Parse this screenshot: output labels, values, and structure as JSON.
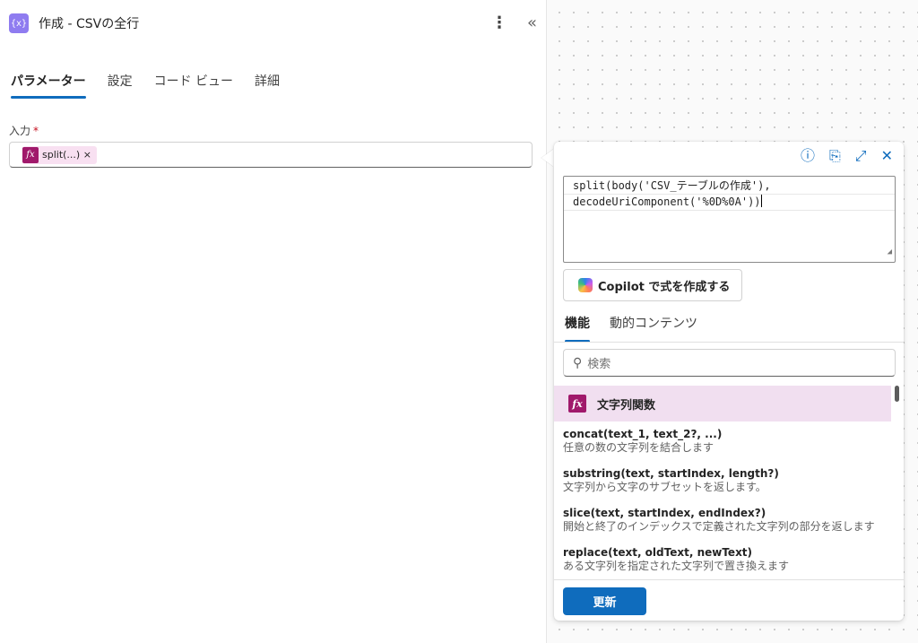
{
  "panel": {
    "title": "作成 - CSVの全行",
    "icon_glyph": "{x}",
    "kebab_glyph": "⋮",
    "collapse_glyph": "«",
    "tabs": [
      {
        "label": "パラメーター",
        "active": true
      },
      {
        "label": "設定",
        "active": false
      },
      {
        "label": "コード ビュー",
        "active": false
      },
      {
        "label": "詳細",
        "active": false
      }
    ],
    "input_label": "入力",
    "required_mark": "*",
    "token": {
      "fx": "fx",
      "text": "split(...) ×"
    }
  },
  "popup": {
    "tools": {
      "info": "ⓘ",
      "paste": "⎘",
      "expand": "⤢",
      "close": "✕"
    },
    "expression_line1": "split(body('CSV_テーブルの作成'),",
    "expression_line2": "decodeUriComponent('%0D%0A'))",
    "copilot_label": "Copilot で式を作成する",
    "tabs": [
      {
        "label": "機能",
        "active": true
      },
      {
        "label": "動的コンテンツ",
        "active": false
      }
    ],
    "search_placeholder": "検索",
    "category": {
      "fx": "fx",
      "label": "文字列関数"
    },
    "functions": [
      {
        "signature": "concat(text_1, text_2?, ...)",
        "description": "任意の数の文字列を結合します"
      },
      {
        "signature": "substring(text, startIndex, length?)",
        "description": "文字列から文字のサブセットを返します。"
      },
      {
        "signature": "slice(text, startIndex, endIndex?)",
        "description": "開始と終了のインデックスで定義された文字列の部分を返します"
      },
      {
        "signature": "replace(text, oldText, newText)",
        "description": "ある文字列を指定された文字列で置き換えます"
      }
    ],
    "update_label": "更新"
  },
  "colors": {
    "accent": "#0f6cbd",
    "function_icon": "#a0196b",
    "category_bg": "#f1dff0",
    "action_icon": "#8f7cf0"
  }
}
